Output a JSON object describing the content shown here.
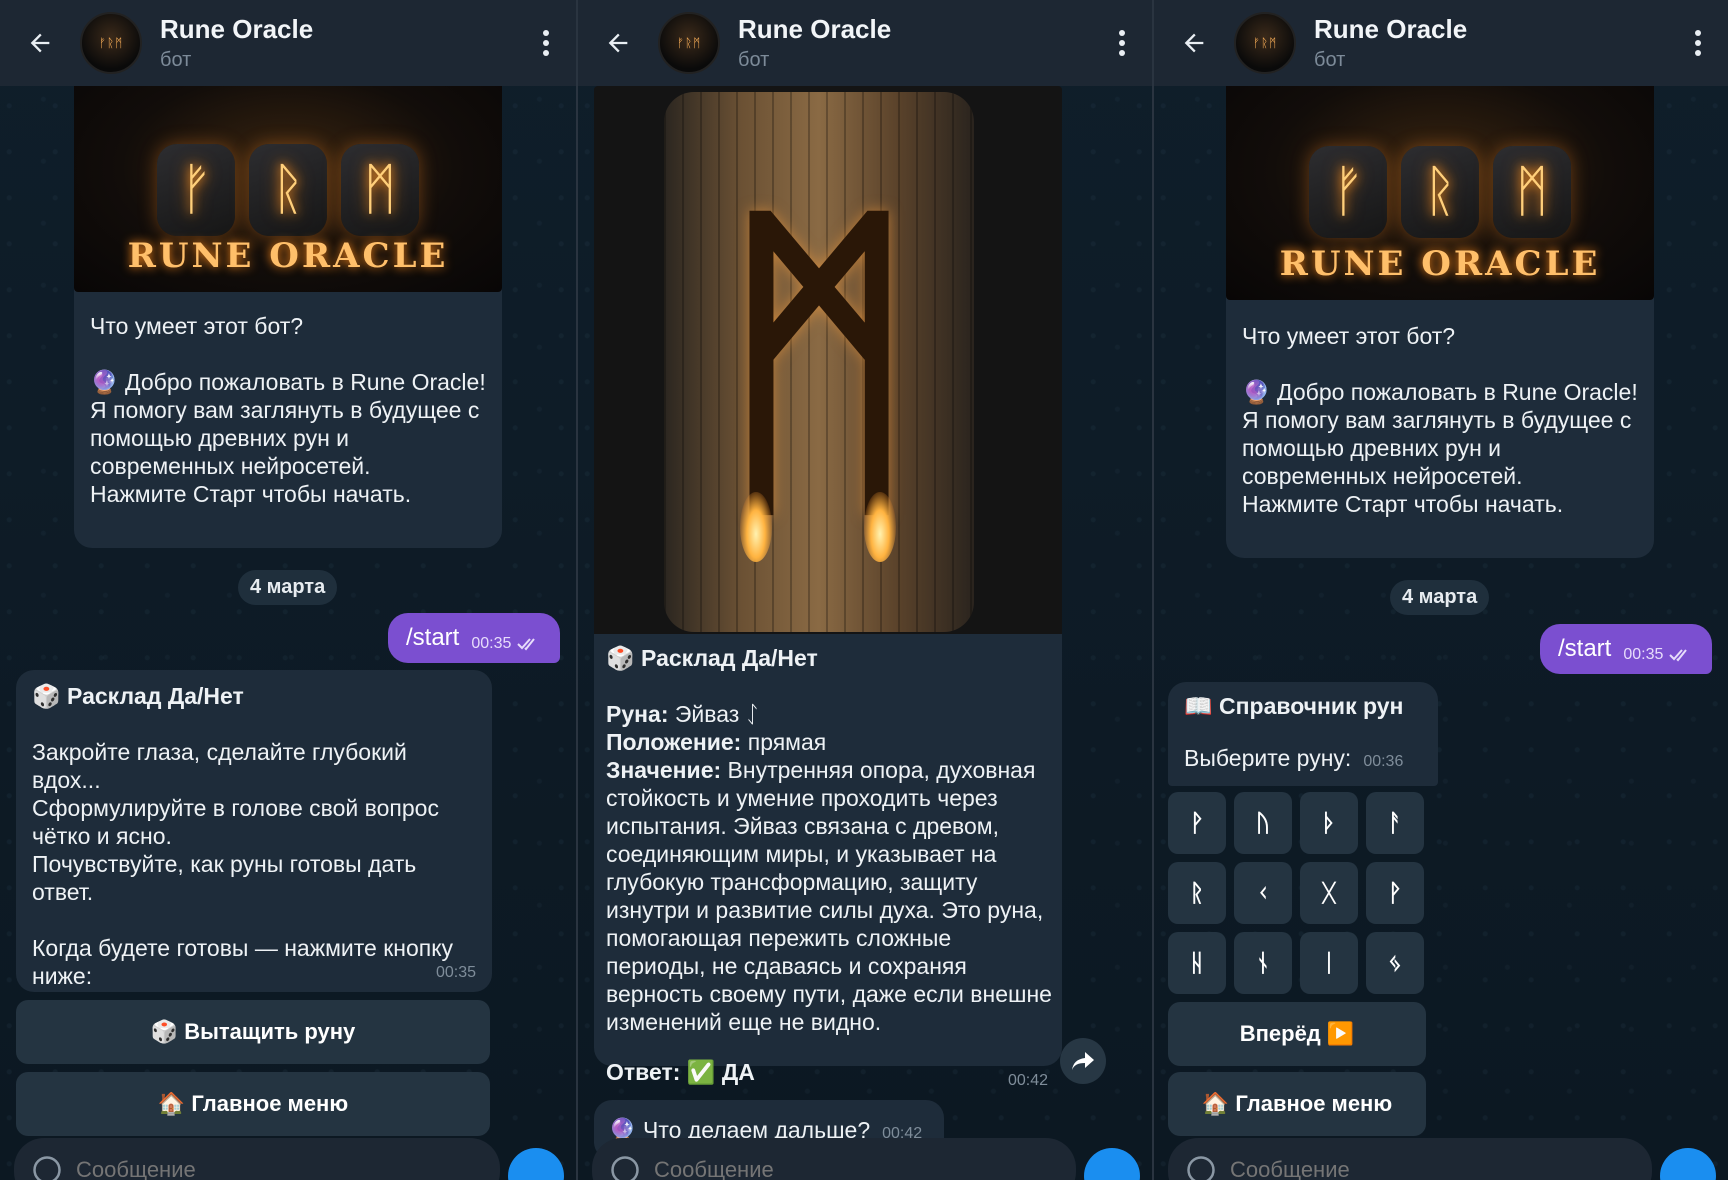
{
  "header": {
    "title": "Rune Oracle",
    "subtitle": "бот",
    "avatar_text": "ᚠᚱᛗ"
  },
  "intro": {
    "banner_runes": [
      "ᚠ",
      "ᚱ",
      "ᛗ"
    ],
    "banner_text": "RUNE ORACLE",
    "heading": "Что умеет этот бот?",
    "emoji": "🔮",
    "body": "Добро пожаловать в Rune Oracle!\nЯ помогу вам заглянуть в будущее с помощью древних рун и современных нейросетей.\nНажмите Старт чтобы начать."
  },
  "date_pill": "4 марта",
  "user_message": {
    "text": "/start",
    "time": "00:35"
  },
  "panel1": {
    "emoji": "🎲",
    "title": "Расклад Да/Нет",
    "body": "Закройте глаза, сделайте глубокий вдох...\nСформулируйте в голове свой вопрос чётко и ясно.\nПочувствуйте, как руны готовы дать ответ.\n\nКогда будете готовы — нажмите кнопку ниже:",
    "time": "00:35",
    "buttons": [
      {
        "label": "🎲 Вытащить руну"
      },
      {
        "label": "🏠 Главное меню"
      }
    ]
  },
  "panel2": {
    "rune_glyph": "ᛗ",
    "title": "🎲 Расклад Да/Нет",
    "rune_label": "Руна:",
    "rune_value": "Эйваз ᛇ",
    "position_label": "Положение:",
    "position_value": "прямая",
    "meaning_label": "Значение:",
    "meaning_value": "Внутренняя опора, духовная стойкость и умение проходить через испытания. Эйваз связана с древом, соединяющим миры, и указывает на глубокую трансформацию, защиту изнутри и развитие силы духа. Это руна, помогающая пережить сложные периоды, не сдаваясь и сохраняя верность своему пути, даже если внешне изменений еще не видно.",
    "answer_label": "Ответ:",
    "answer_value": "✅ ДА",
    "time": "00:42",
    "next_text": "🔮 Что делаем дальше?",
    "next_time": "00:42"
  },
  "panel3": {
    "title": "📖 Справочник рун",
    "prompt": "Выберите руну:",
    "time": "00:36",
    "runes": [
      "ᚹ",
      "ᚢ",
      "ᚦ",
      "ᚨ",
      "ᚱ",
      "ᚲ",
      "ᚷ",
      "ᚹ",
      "ᚺ",
      "ᚾ",
      "ᛁ",
      "ᛃ"
    ],
    "forward_label": "Вперёд ▶️",
    "menu_label": "🏠 Главное меню"
  },
  "input": {
    "placeholder": "Сообщение"
  },
  "colors": {
    "header_bg": "#1d2733",
    "bubble_bg": "#1e2c3a",
    "out_bubble": "#7b4fd0",
    "accent": "#1a8ef0"
  }
}
